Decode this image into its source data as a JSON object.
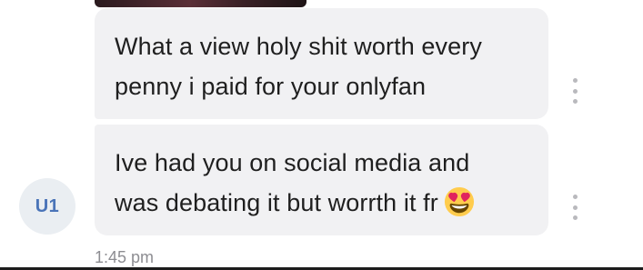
{
  "messages": [
    {
      "lines": [
        "What a view holy shit worth every",
        "penny i paid for your onlyfan"
      ]
    },
    {
      "lines": [
        "Ive had you on social media and",
        "was debating it but worrth it fr"
      ],
      "emoji": "heart-eyes-emoji"
    }
  ],
  "sender": {
    "avatar_initials": "U1"
  },
  "timestamp": "1:45 pm",
  "icons": {
    "more_options": "more-vertical-icon"
  },
  "colors": {
    "bubble_background": "#f1f1f3",
    "avatar_text": "#4a74b8",
    "avatar_background": "#eaeef2",
    "timestamp_text": "#8d8d92"
  }
}
